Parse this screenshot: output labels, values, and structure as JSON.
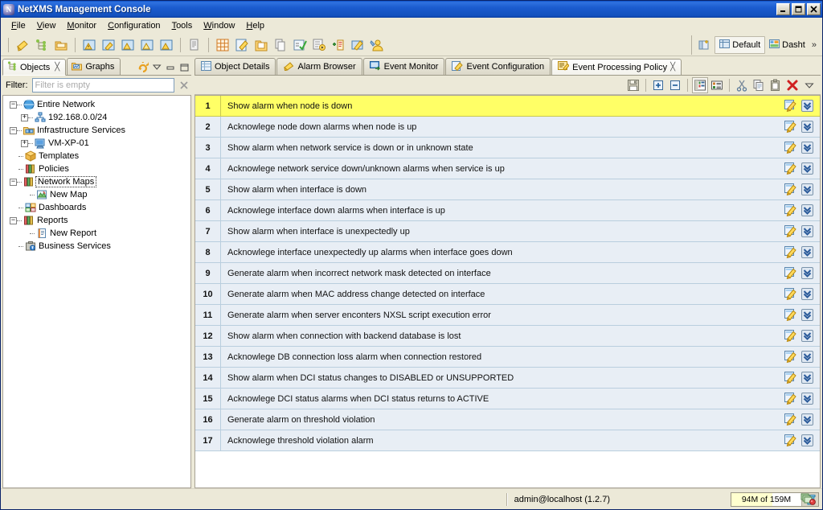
{
  "window": {
    "title": "NetXMS Management Console",
    "app_icon": "netxms-logo-icon",
    "minimize_label": "Minimize",
    "maximize_label": "Maximize",
    "close_label": "Close"
  },
  "menubar": {
    "items": [
      {
        "label": "File",
        "mnemonic": "F"
      },
      {
        "label": "View",
        "mnemonic": "V"
      },
      {
        "label": "Monitor",
        "mnemonic": "M"
      },
      {
        "label": "Configuration",
        "mnemonic": "C"
      },
      {
        "label": "Tools",
        "mnemonic": "T"
      },
      {
        "label": "Window",
        "mnemonic": "W"
      },
      {
        "label": "Help",
        "mnemonic": "H"
      }
    ]
  },
  "toolbar": {
    "groups": [
      {
        "icons": [
          "alarm-browser-icon",
          "object-tree-icon",
          "open-folder-icon"
        ]
      },
      {
        "icons": [
          "alarm-view-icon",
          "alarm-edit-icon",
          "alarm-warning-icon",
          "alarm-minor-icon",
          "alarm-major-icon"
        ]
      },
      {
        "icons": [
          "copy-page-icon"
        ]
      },
      {
        "icons": [
          "grid-icon",
          "edit-note-icon",
          "open-package-icon",
          "duplicate-icon",
          "checklist-icon",
          "script-run-icon",
          "add-entry-icon",
          "screen-edit-icon",
          "user-manage-icon"
        ]
      }
    ],
    "perspectives": {
      "open_perspective_icon": "open-perspective-icon",
      "items": [
        {
          "label": "Default",
          "icon": "default-perspective-icon",
          "active": true
        },
        {
          "label": "Dasht",
          "icon": "dashboard-perspective-icon",
          "active": false
        }
      ],
      "overflow_label": "»"
    }
  },
  "sidebar": {
    "tabs": [
      {
        "label": "Objects",
        "icon": "objects-tree-icon",
        "active": true,
        "closeable": true
      },
      {
        "label": "Graphs",
        "icon": "graphs-folder-icon",
        "active": false,
        "closeable": false
      }
    ],
    "view_tools": [
      {
        "name": "refresh-link-icon"
      },
      {
        "name": "view-menu-chevron-icon"
      },
      {
        "name": "minimize-view-icon"
      },
      {
        "name": "maximize-view-icon"
      }
    ],
    "filter": {
      "label": "Filter:",
      "placeholder": "Filter is empty",
      "value": "",
      "clear_icon": "clear-filter-icon"
    },
    "tree": [
      {
        "label": "Entire Network",
        "icon": "globe-icon",
        "level": 0,
        "expander": "-"
      },
      {
        "label": "192.168.0.0/24",
        "icon": "subnet-icon",
        "level": 1,
        "expander": "+"
      },
      {
        "label": "Infrastructure Services",
        "icon": "infrastructure-folder-icon",
        "level": 0,
        "expander": "-"
      },
      {
        "label": "VM-XP-01",
        "icon": "computer-node-icon",
        "level": 1,
        "expander": "+"
      },
      {
        "label": "Templates",
        "icon": "templates-box-icon",
        "level": 0,
        "expander": ""
      },
      {
        "label": "Policies",
        "icon": "policies-books-icon",
        "level": 0,
        "expander": ""
      },
      {
        "label": "Network Maps",
        "icon": "network-maps-books-icon",
        "level": 0,
        "expander": "-",
        "selected": true
      },
      {
        "label": "New Map",
        "icon": "map-icon",
        "level": 1,
        "expander": ""
      },
      {
        "label": "Dashboards",
        "icon": "dashboards-icon",
        "level": 0,
        "expander": ""
      },
      {
        "label": "Reports",
        "icon": "reports-books-icon",
        "level": 0,
        "expander": "-"
      },
      {
        "label": "New Report",
        "icon": "report-doc-icon",
        "level": 1,
        "expander": ""
      },
      {
        "label": "Business Services",
        "icon": "business-services-icon",
        "level": 0,
        "expander": ""
      }
    ]
  },
  "editor": {
    "tabs": [
      {
        "label": "Object Details",
        "icon": "object-details-icon",
        "active": false,
        "closeable": false
      },
      {
        "label": "Alarm Browser",
        "icon": "alarm-bell-icon",
        "active": false,
        "closeable": false
      },
      {
        "label": "Event Monitor",
        "icon": "event-monitor-icon",
        "active": false,
        "closeable": false
      },
      {
        "label": "Event Configuration",
        "icon": "event-config-icon",
        "active": false,
        "closeable": false
      },
      {
        "label": "Event Processing Policy",
        "icon": "event-policy-icon",
        "active": true,
        "closeable": true
      }
    ],
    "toolbar": [
      {
        "name": "save-icon",
        "framed": false
      },
      {
        "name": "expand-all-icon",
        "framed": false
      },
      {
        "name": "collapse-all-icon",
        "framed": false
      },
      {
        "name": "show-filter-icon",
        "framed": true
      },
      {
        "name": "show-details-icon",
        "framed": false
      },
      {
        "name": "cut-icon",
        "framed": false
      },
      {
        "name": "copy-icon",
        "framed": false
      },
      {
        "name": "paste-icon",
        "framed": false
      },
      {
        "name": "delete-icon",
        "framed": false
      },
      {
        "name": "view-menu-chevron-icon",
        "framed": false
      }
    ],
    "row_icons": {
      "edit_icon": "rule-edit-icon",
      "expand_icon": "rule-expand-chevron-icon"
    },
    "rules": [
      {
        "num": "1",
        "text": "Show alarm when node is down",
        "selected": true
      },
      {
        "num": "2",
        "text": "Acknowlege node down alarms when node is up",
        "selected": false
      },
      {
        "num": "3",
        "text": "Show alarm when network service is down or in unknown state",
        "selected": false
      },
      {
        "num": "4",
        "text": "Acknowlege network service down/unknown alarms when service is up",
        "selected": false
      },
      {
        "num": "5",
        "text": "Show alarm when interface is down",
        "selected": false
      },
      {
        "num": "6",
        "text": "Acknowlege interface down alarms when interface is up",
        "selected": false
      },
      {
        "num": "7",
        "text": "Show alarm when interface is unexpectedly up",
        "selected": false
      },
      {
        "num": "8",
        "text": "Acknowlege interface unexpectedly up alarms when interface goes down",
        "selected": false
      },
      {
        "num": "9",
        "text": "Generate alarm when incorrect network mask detected on interface",
        "selected": false
      },
      {
        "num": "10",
        "text": "Generate alarm when MAC address change detected on interface",
        "selected": false
      },
      {
        "num": "11",
        "text": "Generate alarm when server enconters NXSL script execution error",
        "selected": false
      },
      {
        "num": "12",
        "text": "Show alarm when connection with backend database is lost",
        "selected": false
      },
      {
        "num": "13",
        "text": "Acknowlege DB connection loss alarm when connection restored",
        "selected": false
      },
      {
        "num": "14",
        "text": "Show alarm when DCI status changes to DISABLED or UNSUPPORTED",
        "selected": false
      },
      {
        "num": "15",
        "text": "Acknowlege DCI status alarms when DCI status returns to ACTIVE",
        "selected": false
      },
      {
        "num": "16",
        "text": "Generate alarm on threshold violation",
        "selected": false
      },
      {
        "num": "17",
        "text": "Acknowlege threshold violation alarm",
        "selected": false
      }
    ]
  },
  "statusbar": {
    "user": "admin@localhost (1.2.7)",
    "memory_label": "94M of 159M",
    "memory_used_mb": 94,
    "memory_total_mb": 159,
    "trash_icon": "free-memory-trash-icon",
    "right_icon": "cheat-sheet-icon"
  },
  "colors": {
    "title_bar": "#1350bd",
    "selected_row": "#ffff66",
    "row_background": "#e8eef5",
    "row_border": "#b9cede",
    "chrome": "#ece9d8"
  }
}
